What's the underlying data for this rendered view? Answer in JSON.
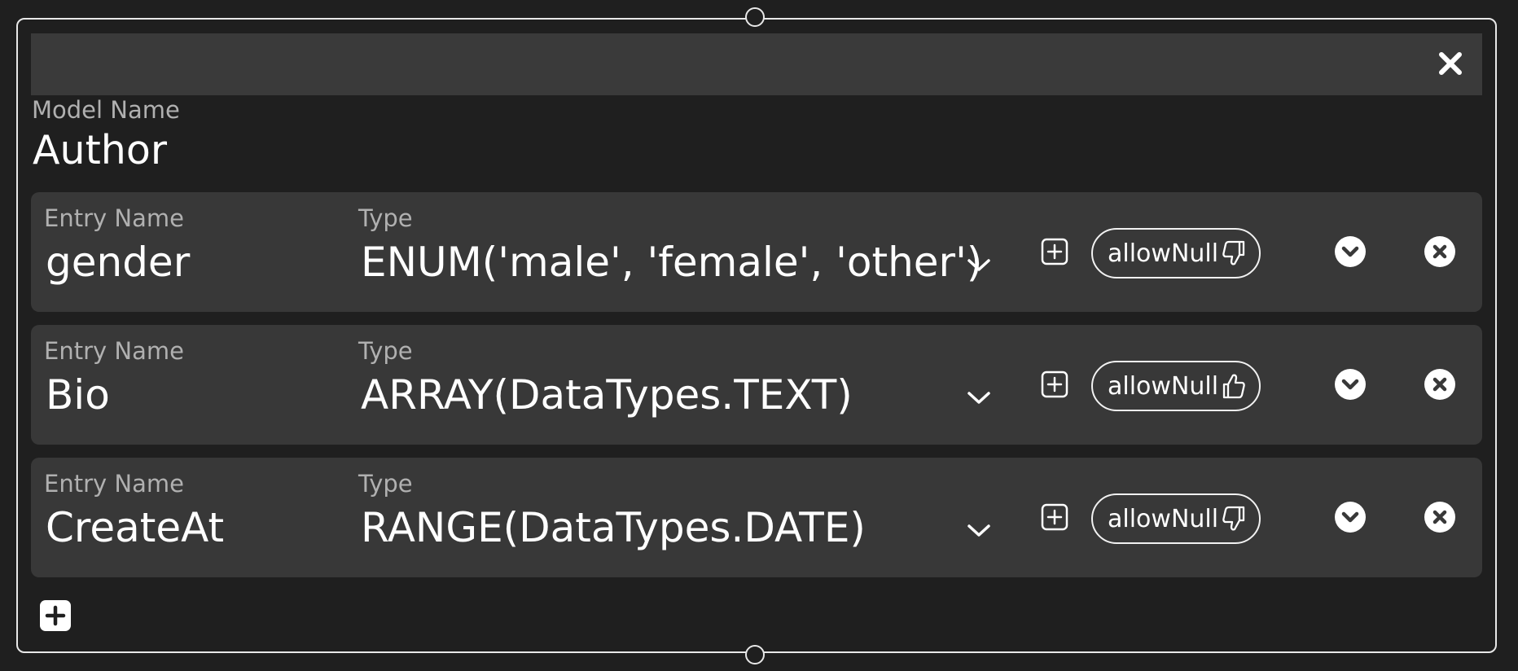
{
  "model": {
    "label": "Model Name",
    "value": "Author"
  },
  "entries": [
    {
      "name_label": "Entry Name",
      "name": "gender",
      "type_label": "Type",
      "type": "ENUM('male', 'female', 'other')",
      "allow_null_label": "allowNull",
      "allow_null_icon": "thumbs-down-icon"
    },
    {
      "name_label": "Entry Name",
      "name": "Bio",
      "type_label": "Type",
      "type": "ARRAY(DataTypes.TEXT)",
      "allow_null_label": "allowNull",
      "allow_null_icon": "thumbs-up-icon"
    },
    {
      "name_label": "Entry Name",
      "name": "CreateAt",
      "type_label": "Type",
      "type": "RANGE(DataTypes.DATE)",
      "allow_null_label": "allowNull",
      "allow_null_icon": "thumbs-down-icon"
    }
  ],
  "colors": {
    "background": "#1f1f1f",
    "panel": "#383838",
    "titlebar": "#3a3a3a",
    "label": "#b0b0b0",
    "text": "#ffffff",
    "border": "#e8e8e8"
  }
}
